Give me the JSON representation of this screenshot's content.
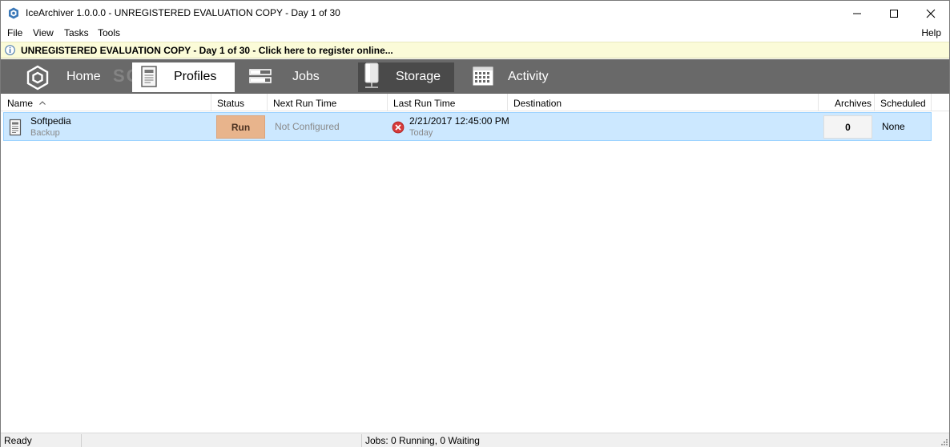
{
  "window": {
    "title": "IceArchiver 1.0.0.0 - UNREGISTERED EVALUATION COPY - Day 1 of 30"
  },
  "menu": {
    "items": [
      "File",
      "View",
      "Tasks",
      "Tools"
    ],
    "help": "Help"
  },
  "notice": {
    "text": "UNREGISTERED EVALUATION COPY - Day 1 of 30 - Click here to register online...",
    "icon": "info-icon"
  },
  "toolbar": {
    "home": "Home",
    "profiles": "Profiles",
    "jobs": "Jobs",
    "storage": "Storage",
    "activity": "Activity",
    "active_tab": "Profiles",
    "watermark": "SOFTPEDIA"
  },
  "grid": {
    "columns": {
      "name": "Name",
      "status": "Status",
      "next_run": "Next Run Time",
      "last_run": "Last Run Time",
      "destination": "Destination",
      "archives": "Archives",
      "scheduled": "Scheduled"
    },
    "sorted_by": "Name",
    "rows": [
      {
        "name": "Softpedia",
        "type": "Backup",
        "status": "Run",
        "next_run": "Not Configured",
        "last_run": "2/21/2017 12:45:00 PM",
        "last_run_sub": "Today",
        "destination": "",
        "archives": "0",
        "scheduled": "None"
      }
    ]
  },
  "statusbar": {
    "state": "Ready",
    "jobs": "Jobs: 0 Running, 0 Waiting"
  },
  "colors": {
    "toolbar_bg": "#696969",
    "selection_bg": "#cce8ff",
    "run_button": "#e8b48c",
    "notice_bg": "#fbfbd8",
    "error_red": "#d63a3a"
  }
}
